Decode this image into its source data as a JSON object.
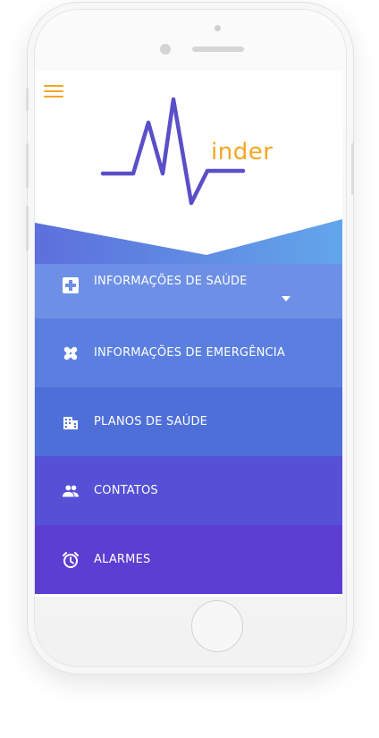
{
  "app": {
    "logo_text": "inder",
    "accent_color": "#f5a623",
    "logo_line_color": "#5a4fc8"
  },
  "menu": {
    "items": [
      {
        "label": "INFORMAÇÕES DE SAÚDE",
        "icon": "medical-plus-icon",
        "expanded": true
      },
      {
        "label": "INFORMAÇÕES DE EMERGÊNCIA",
        "icon": "bandage-icon"
      },
      {
        "label": "PLANOS DE SAÚDE",
        "icon": "hospital-building-icon"
      },
      {
        "label": "CONTATOS",
        "icon": "people-icon"
      },
      {
        "label": "ALARMES",
        "icon": "alarm-clock-icon"
      }
    ]
  },
  "colors": {
    "item_0": "#6d8fe6",
    "item_1": "#5a7fe0",
    "item_2": "#4f6fd8",
    "item_3": "#5550d6",
    "item_4": "#5c3ed3"
  }
}
